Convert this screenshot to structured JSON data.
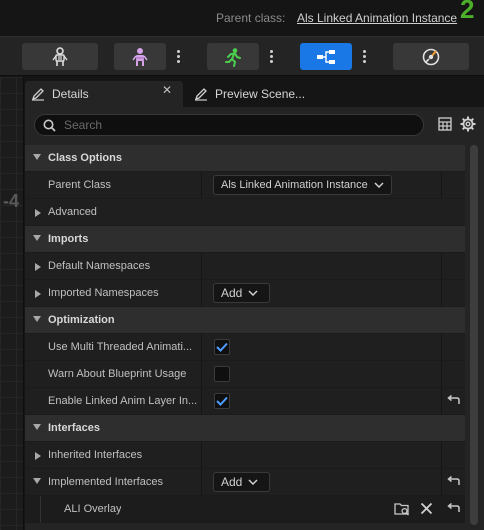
{
  "header": {
    "parent_class_label": "Parent class:",
    "parent_class_value": "Als Linked Animation Instance",
    "corner_digit": "2"
  },
  "toolbar": {
    "buttons": [
      {
        "icon": "skeleton-icon"
      },
      {
        "icon": "mesh-icon"
      },
      {
        "icon": "animation-icon"
      },
      {
        "icon": "blueprint-icon",
        "active": true
      },
      {
        "icon": "physics-icon"
      }
    ],
    "accent_color": "#1a78e6"
  },
  "graph": {
    "number": "-4"
  },
  "tabs": [
    {
      "label": "Details",
      "icon": "pencil-icon",
      "active": true
    },
    {
      "label": "Preview Scene...",
      "icon": "pencil-icon",
      "active": false
    }
  ],
  "search": {
    "placeholder": "Search",
    "value": ""
  },
  "details": {
    "class_options": "Class Options",
    "parent_class": "Parent Class",
    "parent_class_value": "Als Linked Animation Instance",
    "advanced": "Advanced",
    "imports": "Imports",
    "default_namespaces": "Default Namespaces",
    "imported_namespaces": "Imported Namespaces",
    "add_label": "Add",
    "optimization": "Optimization",
    "use_multi_threaded": "Use Multi Threaded Animati...",
    "warn_blueprint": "Warn About Blueprint Usage",
    "enable_linked": "Enable Linked Anim Layer In...",
    "interfaces": "Interfaces",
    "inherited_interfaces": "Inherited Interfaces",
    "implemented_interfaces": "Implemented Interfaces",
    "ali_overlay": "ALI Overlay"
  },
  "checkbox_states": {
    "use_multi_threaded": true,
    "warn_blueprint": false,
    "enable_linked": true
  }
}
